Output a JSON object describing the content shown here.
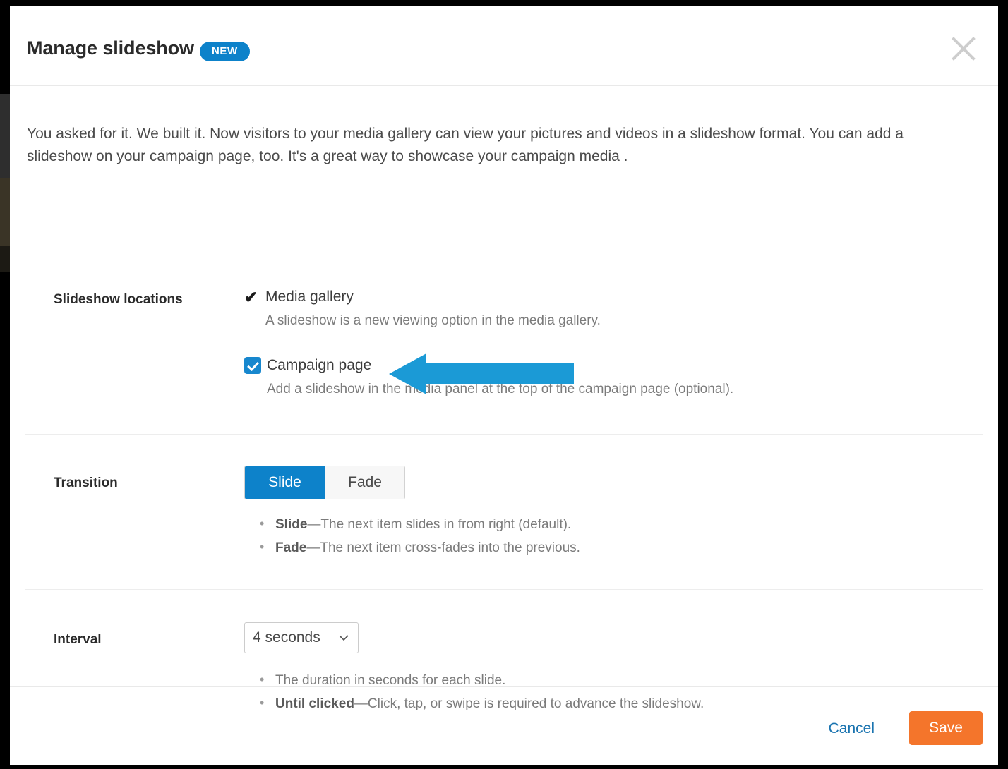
{
  "modal": {
    "title": "Manage slideshow",
    "badge": "NEW",
    "close_icon": "close-icon",
    "intro": "You asked for it. We built it. Now visitors to your media gallery can view your pictures and videos in a slideshow format. You can add a slideshow on your campaign page, too. It's a great way to showcase your campaign media ."
  },
  "locations": {
    "label": "Slideshow locations",
    "options": [
      {
        "label": "Media gallery",
        "help": "A slideshow is a new viewing option in the media gallery.",
        "control": "checkmark",
        "checked": true
      },
      {
        "label": "Campaign page",
        "help": "Add a slideshow in the media panel at the top of the campaign page (optional).",
        "control": "checkbox",
        "checked": true
      }
    ]
  },
  "transition": {
    "label": "Transition",
    "options": [
      {
        "label": "Slide",
        "active": true
      },
      {
        "label": "Fade",
        "active": false
      }
    ],
    "notes": [
      {
        "term": "Slide",
        "desc": "—The next item slides in from right (default)."
      },
      {
        "term": "Fade",
        "desc": "—The next item cross-fades into the previous."
      }
    ]
  },
  "interval": {
    "label": "Interval",
    "value": "4 seconds",
    "notes": [
      {
        "term": "",
        "desc": "The duration in seconds for each slide."
      },
      {
        "term": "Until clicked",
        "desc": "—Click, tap, or swipe is required to advance the slideshow."
      }
    ]
  },
  "footer": {
    "cancel_label": "Cancel",
    "save_label": "Save"
  },
  "colors": {
    "accent_blue": "#0d82ca",
    "checkbox_blue": "#1787ce",
    "save_orange": "#f4752b",
    "link_blue": "#1a74b0",
    "annotation_blue": "#1b9ad6"
  }
}
